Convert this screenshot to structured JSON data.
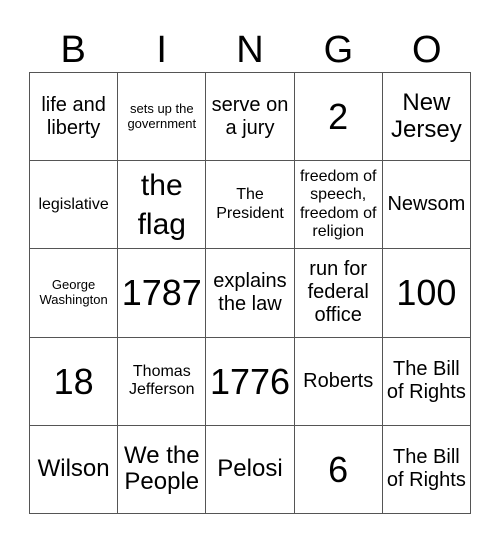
{
  "header": [
    "B",
    "I",
    "N",
    "G",
    "O"
  ],
  "cells": [
    {
      "text": "life and liberty",
      "size": "s-md"
    },
    {
      "text": "sets up the government",
      "size": "s-xs"
    },
    {
      "text": "serve on a jury",
      "size": "s-md"
    },
    {
      "text": "2",
      "size": "s-xxl"
    },
    {
      "text": "New Jersey",
      "size": "s-lg"
    },
    {
      "text": "legislative",
      "size": "s-sm"
    },
    {
      "text": "the flag",
      "size": "s-xl"
    },
    {
      "text": "The President",
      "size": "s-sm"
    },
    {
      "text": "freedom of speech, freedom of religion",
      "size": "s-sm"
    },
    {
      "text": "Newsom",
      "size": "s-md"
    },
    {
      "text": "George Washington",
      "size": "s-xs"
    },
    {
      "text": "1787",
      "size": "s-xxl"
    },
    {
      "text": "explains the law",
      "size": "s-md"
    },
    {
      "text": "run for federal office",
      "size": "s-md"
    },
    {
      "text": "100",
      "size": "s-xxl"
    },
    {
      "text": "18",
      "size": "s-xxl"
    },
    {
      "text": "Thomas Jefferson",
      "size": "s-sm"
    },
    {
      "text": "1776",
      "size": "s-xxl"
    },
    {
      "text": "Roberts",
      "size": "s-md"
    },
    {
      "text": "The Bill of Rights",
      "size": "s-md"
    },
    {
      "text": "Wilson",
      "size": "s-lg"
    },
    {
      "text": "We the People",
      "size": "s-lg"
    },
    {
      "text": "Pelosi",
      "size": "s-lg"
    },
    {
      "text": "6",
      "size": "s-xxl"
    },
    {
      "text": "The Bill of Rights",
      "size": "s-md"
    }
  ]
}
